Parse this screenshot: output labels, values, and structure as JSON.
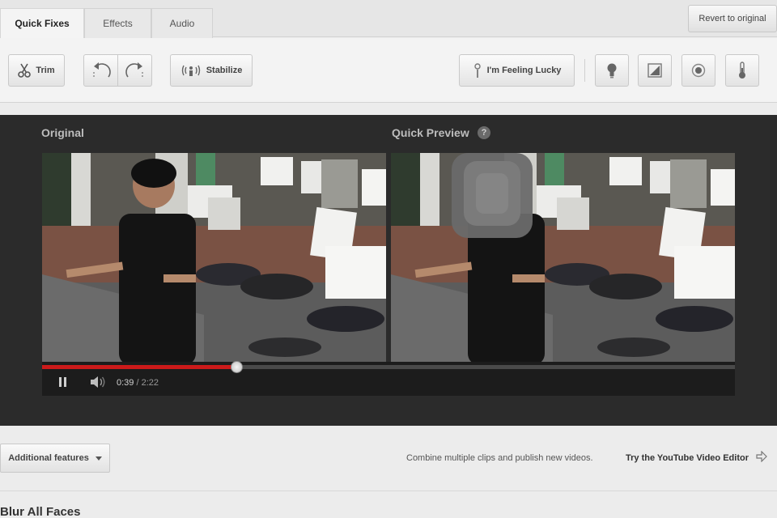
{
  "tabs": [
    {
      "label": "Quick Fixes",
      "active": true
    },
    {
      "label": "Effects",
      "active": false
    },
    {
      "label": "Audio",
      "active": false
    }
  ],
  "revert_label": "Revert to original",
  "toolbar": {
    "trim_label": "Trim",
    "stabilize_label": "Stabilize",
    "lucky_label": "I'm Feeling Lucky",
    "icons": [
      "scissors-icon",
      "rotate-left-icon",
      "rotate-right-icon",
      "stabilize-icon",
      "lightbulb-icon",
      "contrast-icon",
      "saturation-icon",
      "thermometer-icon"
    ]
  },
  "preview": {
    "original_label": "Original",
    "quick_preview_label": "Quick Preview",
    "help_glyph": "?"
  },
  "player": {
    "current_time": "0:39",
    "separator": " / ",
    "duration": "2:22",
    "progress": 0.28,
    "accent": "#cc1a1a"
  },
  "bottom": {
    "additional_features_label": "Additional features",
    "combine_text": "Combine multiple clips and publish new videos.",
    "editor_link": "Try the YouTube Video Editor"
  },
  "section_title": "Blur All Faces"
}
